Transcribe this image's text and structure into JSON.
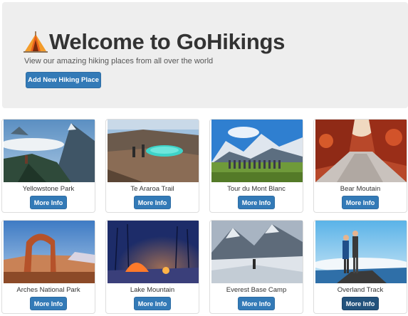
{
  "header": {
    "title": "Welcome to GoHikings",
    "subtitle": "View our amazing hiking places from all over the world",
    "add_button_label": "Add New Hiking Place",
    "icon": "tent-icon"
  },
  "places": [
    {
      "name": "Yellowstone Park",
      "button_label": "More Info"
    },
    {
      "name": "Te Araroa Trail",
      "button_label": "More Info"
    },
    {
      "name": "Tour du Mont Blanc",
      "button_label": "More Info"
    },
    {
      "name": "Bear Moutain",
      "button_label": "More Info"
    },
    {
      "name": "Arches National Park",
      "button_label": "More Info"
    },
    {
      "name": "Lake Mountain",
      "button_label": "More Info"
    },
    {
      "name": "Everest Base Camp",
      "button_label": "More Info"
    },
    {
      "name": "Overland Track",
      "button_label": "More Info"
    }
  ],
  "colors": {
    "jumbotron_bg": "#eeeeee",
    "primary_button": "#337ab7",
    "primary_button_active": "#23527c"
  }
}
